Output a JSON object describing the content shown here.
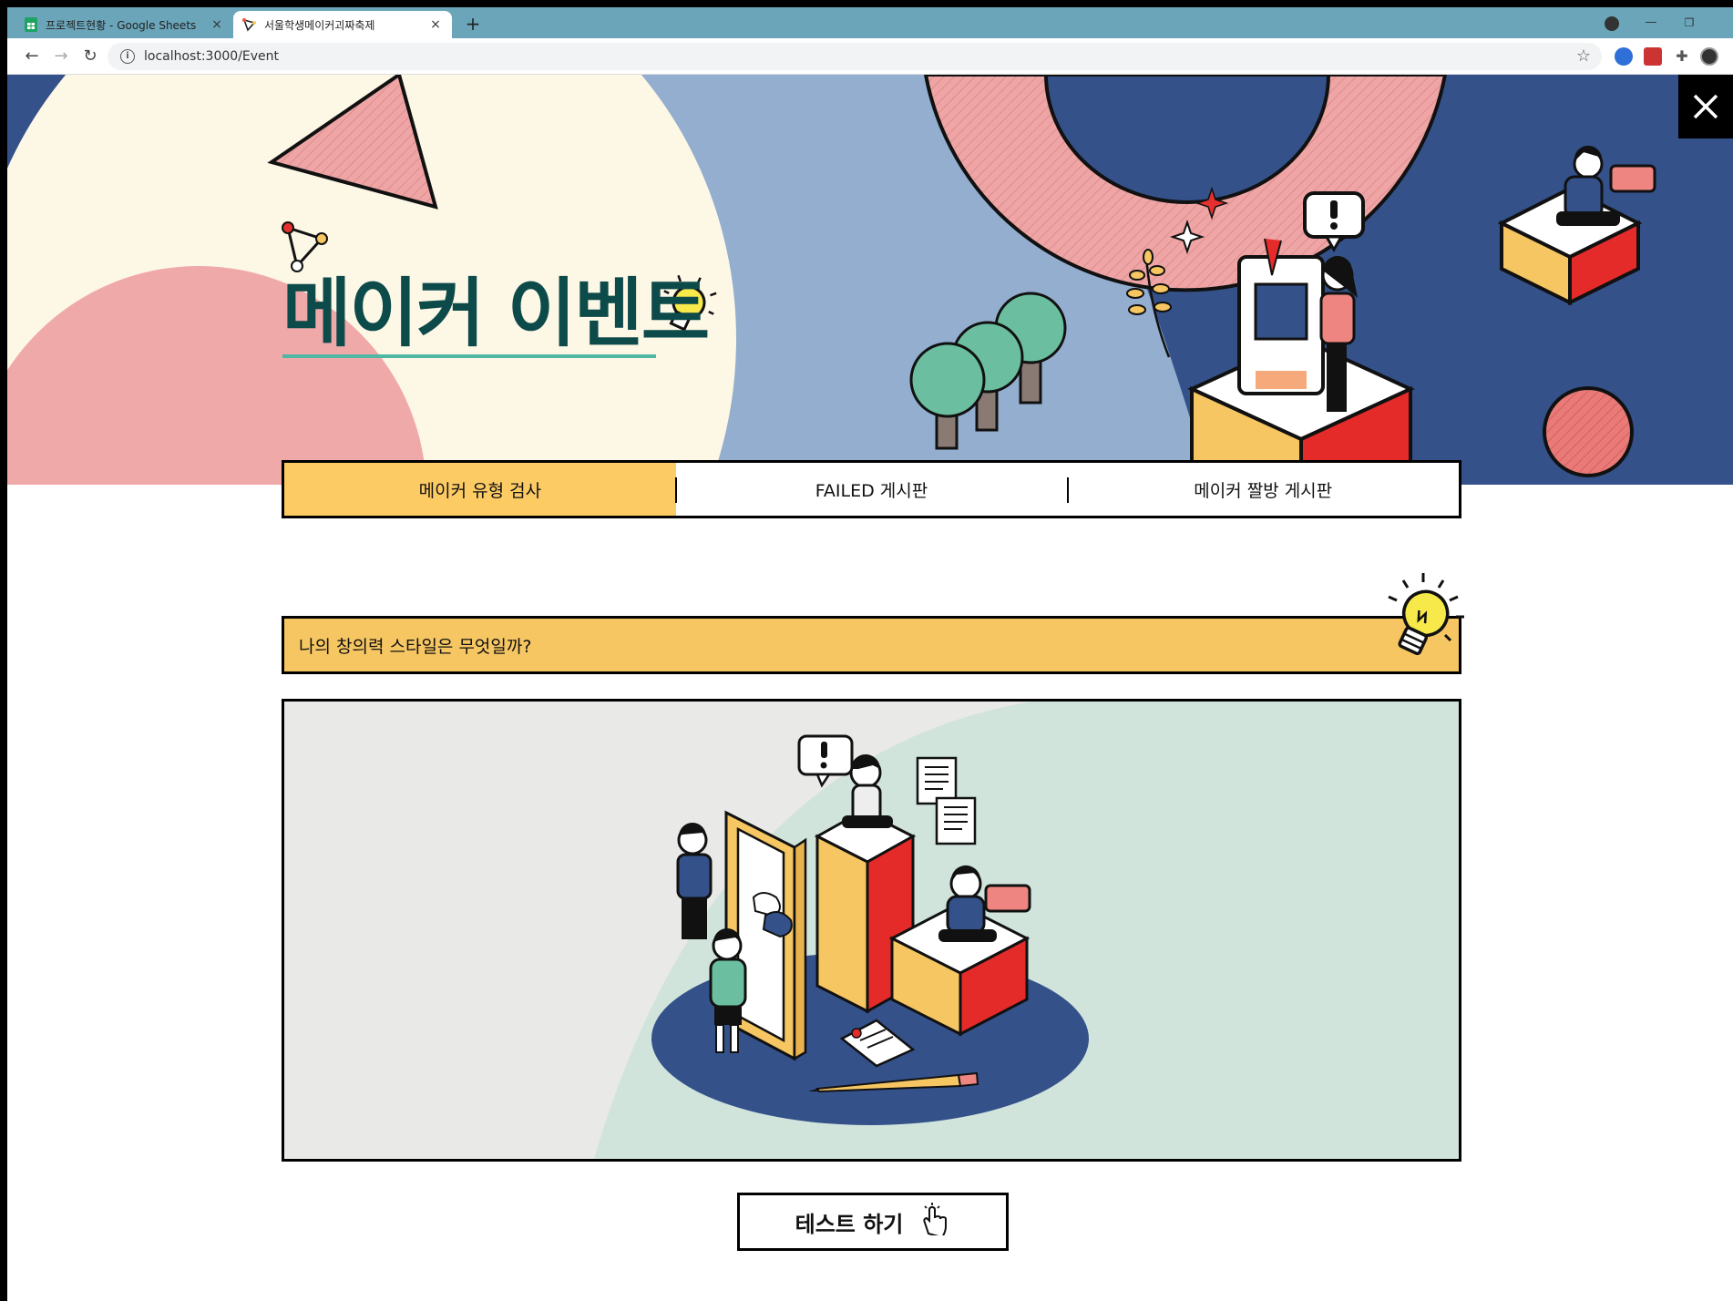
{
  "browser": {
    "tabs": [
      {
        "title": "프로젝트현황 - Google Sheets",
        "active": false
      },
      {
        "title": "서울학생메이커괴짜축제",
        "active": true
      }
    ],
    "url": "localhost:3000/Event",
    "new_tab_label": "+",
    "tab_close": "×"
  },
  "hero": {
    "title": "메이커 이벤트"
  },
  "nav_tabs": [
    {
      "label": "메이커 유형 검사",
      "active": true
    },
    {
      "label": "FAILED 게시판",
      "active": false
    },
    {
      "label": "메이커 짤방 게시판",
      "active": false
    }
  ],
  "question": {
    "text": "나의 창의력 스타일은 무엇일까?"
  },
  "cta": {
    "label": "테스트 하기"
  },
  "colors": {
    "accent_yellow": "#fdcb64",
    "title_teal": "#0d4a4a",
    "pink": "#f0a9a9",
    "navy": "#34518a",
    "light_blue": "#93aecf",
    "cream": "#fdf7e6"
  }
}
